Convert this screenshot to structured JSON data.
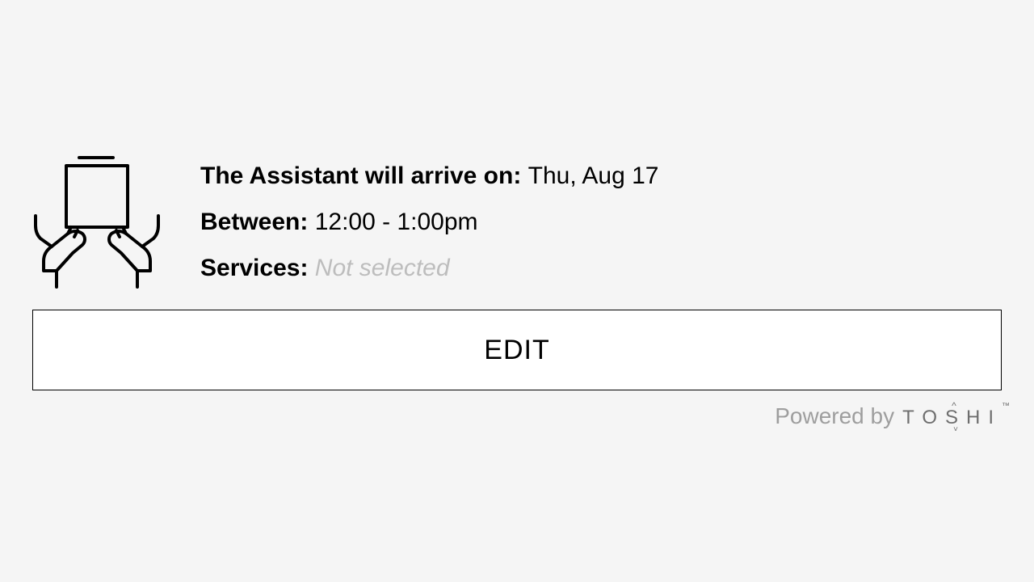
{
  "summary": {
    "arrival_label": "The Assistant will arrive on: ",
    "arrival_value": "Thu, Aug 17",
    "between_label": "Between: ",
    "between_value": "12:00 - 1:00pm",
    "services_label": "Services: ",
    "services_value": "Not selected"
  },
  "actions": {
    "edit_label": "EDIT"
  },
  "footer": {
    "powered_by": "Powered by",
    "brand": "TOSHI"
  }
}
